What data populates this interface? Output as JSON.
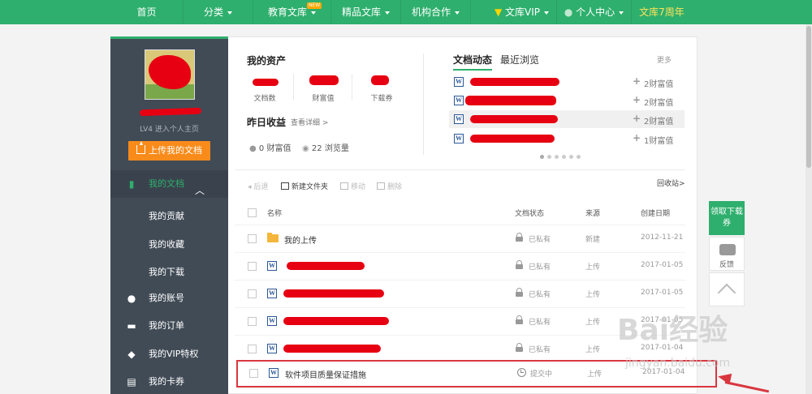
{
  "nav": {
    "items": [
      {
        "label": "首页",
        "caret": false
      },
      {
        "label": "分类",
        "caret": true
      },
      {
        "label": "教育文库",
        "caret": true,
        "badge": "NEW"
      },
      {
        "label": "精品文库",
        "caret": true
      },
      {
        "label": "机构合作",
        "caret": true
      },
      {
        "label": "文库VIP",
        "caret": true
      },
      {
        "label": "个人中心",
        "caret": true
      },
      {
        "label": "文库7周年",
        "caret": false
      }
    ],
    "bg_color": "#2eaf6d"
  },
  "sidebar": {
    "level_text": "LV4  进入个人主页",
    "upload_label": "上传我的文档",
    "items": [
      {
        "label": "我的文档",
        "icon": "document-icon",
        "active": true
      },
      {
        "label": "我的贡献",
        "sub": true
      },
      {
        "label": "我的收藏",
        "sub": true
      },
      {
        "label": "我的下载",
        "sub": true
      },
      {
        "label": "我的账号",
        "icon": "user-icon"
      },
      {
        "label": "我的订单",
        "icon": "cart-icon"
      },
      {
        "label": "我的VIP特权",
        "icon": "diamond-icon"
      },
      {
        "label": "我的卡券",
        "icon": "ticket-icon"
      }
    ]
  },
  "assets": {
    "title": "我的资产",
    "labels": [
      "文档数",
      "财富值",
      "下载券"
    ]
  },
  "earnings": {
    "title": "昨日收益",
    "details_link": "查看详细 >",
    "wealth": "0 财富值",
    "views": "22 浏览量"
  },
  "activity": {
    "tab_active": "文档动态",
    "tab_other": "最近浏览",
    "more": "更多",
    "rows": [
      {
        "title": "",
        "value": "2财富值"
      },
      {
        "title": "",
        "value": "2财富值"
      },
      {
        "title": "",
        "value": "2财富值"
      },
      {
        "title": "",
        "value": "1财富值"
      }
    ]
  },
  "toolbar": {
    "back": "后退",
    "new_folder": "新建文件夹",
    "move": "移动",
    "delete": "删除",
    "recycle": "回收站>"
  },
  "table": {
    "headers": {
      "name": "名称",
      "status": "文档状态",
      "source": "来源",
      "date": "创建日期"
    },
    "rows": [
      {
        "name": "我的上传",
        "type": "folder",
        "status": "已私有",
        "source": "新建",
        "date": "2012-11-21"
      },
      {
        "name": "",
        "type": "word",
        "status": "已私有",
        "source": "上传",
        "date": "2017-01-05"
      },
      {
        "name": "",
        "type": "word",
        "status": "已私有",
        "source": "上传",
        "date": "2017-01-05"
      },
      {
        "name": "",
        "type": "word",
        "status": "已私有",
        "source": "上传",
        "date": "2017-01-05"
      },
      {
        "name": "",
        "type": "word",
        "status": "已私有",
        "source": "上传",
        "date": "2017-01-04"
      },
      {
        "name": "软件项目质量保证措施",
        "type": "word",
        "status": "提交中",
        "source": "上传",
        "date": "2017-01-04"
      }
    ]
  },
  "float": {
    "coupon": "领取下载券",
    "feedback": "反馈"
  },
  "watermark": {
    "brand": "Bai经验",
    "url": "jingyan.baidu.com"
  }
}
